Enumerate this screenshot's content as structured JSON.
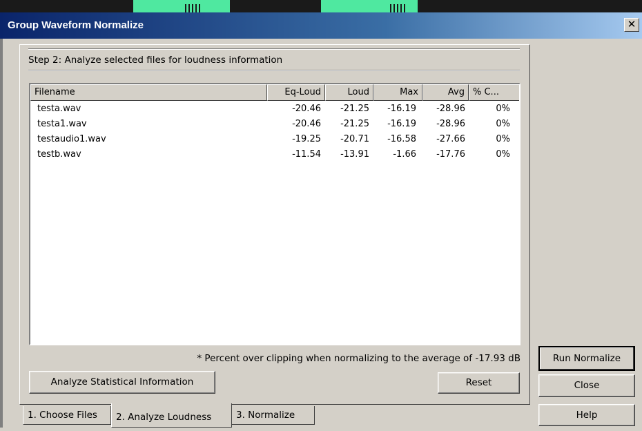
{
  "dialog": {
    "title": "Group Waveform Normalize",
    "close_glyph": "✕"
  },
  "step": {
    "label": "Step 2:  Analyze selected files for loudness information"
  },
  "table": {
    "columns": [
      "Filename",
      "Eq-Loud",
      "Loud",
      "Max",
      "Avg",
      "% C..."
    ],
    "rows": [
      {
        "filename": "testa.wav",
        "eq_loud": "-20.46",
        "loud": "-21.25",
        "max": "-16.19",
        "avg": "-28.96",
        "clip": "0%"
      },
      {
        "filename": "testa1.wav",
        "eq_loud": "-20.46",
        "loud": "-21.25",
        "max": "-16.19",
        "avg": "-28.96",
        "clip": "0%"
      },
      {
        "filename": "testaudio1.wav",
        "eq_loud": "-19.25",
        "loud": "-20.71",
        "max": "-16.58",
        "avg": "-27.66",
        "clip": "0%"
      },
      {
        "filename": "testb.wav",
        "eq_loud": "-11.54",
        "loud": "-13.91",
        "max": "-1.66",
        "avg": "-17.76",
        "clip": "0%"
      }
    ]
  },
  "footnote": "* Percent over clipping when normalizing to the average of -17.93 dB",
  "buttons": {
    "analyze_stats": "Analyze Statistical Information",
    "reset": "Reset",
    "run_normalize": "Run Normalize",
    "close": "Close",
    "help": "Help"
  },
  "tabs": [
    "1. Choose Files",
    "2. Analyze Loudness",
    "3. Normalize"
  ],
  "active_tab": "2. Analyze Loudness",
  "colors": {
    "titlebar_start": "#0a246a",
    "titlebar_end": "#a6caf0",
    "dialog_bg": "#d4d0c8",
    "waveform_green": "#4fe8a0"
  }
}
